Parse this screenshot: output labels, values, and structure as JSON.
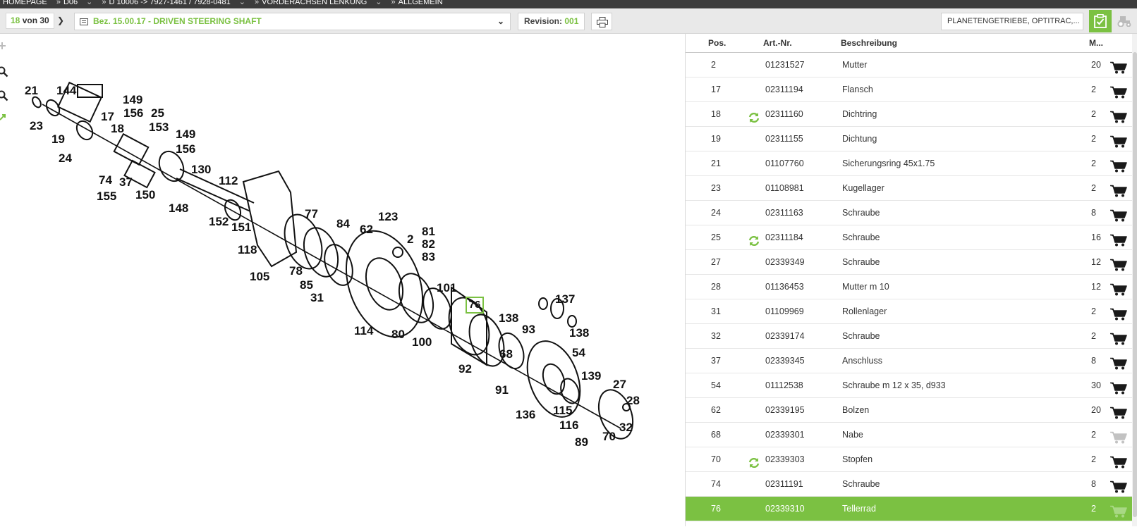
{
  "breadcrumb": {
    "items": [
      "HOMEPAGE",
      "D06",
      "D 10006 -> 7927-1461 / 7928-0481",
      "VORDERACHSEN LENKUNG",
      "ALLGEMEIN"
    ]
  },
  "toolbar": {
    "current_index": "18",
    "of_total": "von 30",
    "drawing_title": "Bez. 15.00.17 - DRIVEN STEERING SHAFT",
    "revision_label": "Revision:",
    "revision_value": "001",
    "filter_value": "PLANETENGETRIEBE, OPTITRAC,..."
  },
  "colors": {
    "accent": "#7bc142",
    "topbar": "#3c3c3c"
  },
  "diagram": {
    "labels": [
      "21",
      "144",
      "23",
      "19",
      "17",
      "18",
      "24",
      "149",
      "156",
      "25",
      "153",
      "149",
      "156",
      "74",
      "37",
      "155",
      "150",
      "130",
      "112",
      "148",
      "152",
      "151",
      "77",
      "84",
      "123",
      "62",
      "2",
      "81",
      "82",
      "83",
      "118",
      "105",
      "78",
      "85",
      "31",
      "114",
      "101",
      "80",
      "100",
      "76",
      "138",
      "137",
      "138",
      "68",
      "93",
      "92",
      "91",
      "54",
      "139",
      "136",
      "115",
      "116",
      "27",
      "28",
      "89",
      "70",
      "32"
    ]
  },
  "table": {
    "headers": {
      "pos": "Pos.",
      "art": "Art.-Nr.",
      "desc": "Beschreibung",
      "qty": "M..."
    },
    "rows": [
      {
        "pos": "2",
        "art": "01231527",
        "desc": "Mutter",
        "qty": "20",
        "substitute": false,
        "cart": "active"
      },
      {
        "pos": "17",
        "art": "02311194",
        "desc": "Flansch",
        "qty": "2",
        "substitute": false,
        "cart": "active"
      },
      {
        "pos": "18",
        "art": "02311160",
        "desc": "Dichtring",
        "qty": "2",
        "substitute": true,
        "cart": "active"
      },
      {
        "pos": "19",
        "art": "02311155",
        "desc": "Dichtung",
        "qty": "2",
        "substitute": false,
        "cart": "active"
      },
      {
        "pos": "21",
        "art": "01107760",
        "desc": "Sicherungsring 45x1.75",
        "qty": "2",
        "substitute": false,
        "cart": "active"
      },
      {
        "pos": "23",
        "art": "01108981",
        "desc": "Kugellager",
        "qty": "2",
        "substitute": false,
        "cart": "active"
      },
      {
        "pos": "24",
        "art": "02311163",
        "desc": "Schraube",
        "qty": "8",
        "substitute": false,
        "cart": "active"
      },
      {
        "pos": "25",
        "art": "02311184",
        "desc": "Schraube",
        "qty": "16",
        "substitute": true,
        "cart": "active"
      },
      {
        "pos": "27",
        "art": "02339349",
        "desc": "Schraube",
        "qty": "12",
        "substitute": false,
        "cart": "active"
      },
      {
        "pos": "28",
        "art": "01136453",
        "desc": "Mutter m 10",
        "qty": "12",
        "substitute": false,
        "cart": "active"
      },
      {
        "pos": "31",
        "art": "01109969",
        "desc": "Rollenlager",
        "qty": "2",
        "substitute": false,
        "cart": "active"
      },
      {
        "pos": "32",
        "art": "02339174",
        "desc": "Schraube",
        "qty": "2",
        "substitute": false,
        "cart": "active"
      },
      {
        "pos": "37",
        "art": "02339345",
        "desc": "Anschluss",
        "qty": "8",
        "substitute": false,
        "cart": "active"
      },
      {
        "pos": "54",
        "art": "01112538",
        "desc": "Schraube m 12 x 35, d933",
        "qty": "30",
        "substitute": false,
        "cart": "active"
      },
      {
        "pos": "62",
        "art": "02339195",
        "desc": "Bolzen",
        "qty": "20",
        "substitute": false,
        "cart": "active"
      },
      {
        "pos": "68",
        "art": "02339301",
        "desc": "Nabe",
        "qty": "2",
        "substitute": false,
        "cart": "disabled"
      },
      {
        "pos": "70",
        "art": "02339303",
        "desc": "Stopfen",
        "qty": "2",
        "substitute": true,
        "cart": "active"
      },
      {
        "pos": "74",
        "art": "02311191",
        "desc": "Schraube",
        "qty": "8",
        "substitute": false,
        "cart": "active"
      },
      {
        "pos": "76",
        "art": "02339310",
        "desc": "Tellerrad",
        "qty": "2",
        "substitute": false,
        "cart": "disabled",
        "selected": true
      }
    ]
  }
}
